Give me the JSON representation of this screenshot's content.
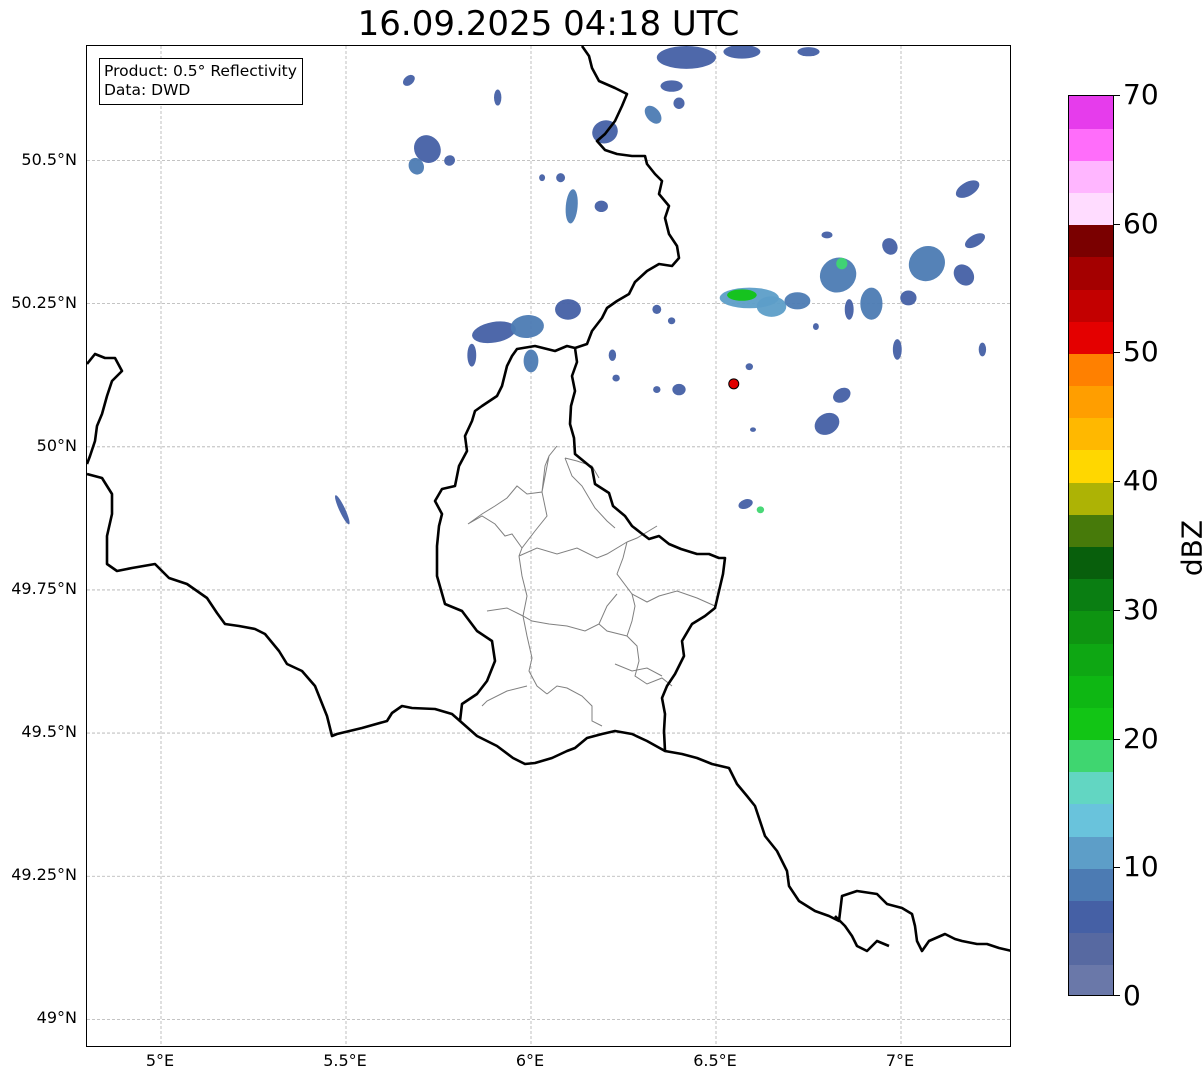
{
  "title": "16.09.2025 04:18 UTC",
  "info_box": {
    "product": "Product: 0.5° Reflectivity",
    "source": "Data: DWD"
  },
  "map": {
    "lon_range": [
      4.8,
      7.3
    ],
    "lat_range": [
      48.95,
      50.7
    ],
    "lat_ticks": [
      {
        "value": 50.5,
        "label": "50.5°N"
      },
      {
        "value": 50.25,
        "label": "50.25°N"
      },
      {
        "value": 50.0,
        "label": "50°N"
      },
      {
        "value": 49.75,
        "label": "49.75°N"
      },
      {
        "value": 49.5,
        "label": "49.5°N"
      },
      {
        "value": 49.25,
        "label": "49.25°N"
      },
      {
        "value": 49.0,
        "label": "49°N"
      }
    ],
    "lon_ticks": [
      {
        "value": 5.0,
        "label": "5°E"
      },
      {
        "value": 5.5,
        "label": "5.5°E"
      },
      {
        "value": 6.0,
        "label": "6°E"
      },
      {
        "value": 6.5,
        "label": "6.5°E"
      },
      {
        "value": 7.0,
        "label": "7°E"
      }
    ],
    "grid_color": "#b0b0b0",
    "border_color": "#000000",
    "admin_color": "#808080",
    "radar_site": {
      "lon": 6.548,
      "lat": 50.11,
      "color": "#e00000"
    },
    "echoes": [
      {
        "lon": 5.72,
        "lat": 50.52,
        "rx": 0.035,
        "ry": 0.025,
        "rot": -35,
        "dbz": 6
      },
      {
        "lon": 5.69,
        "lat": 50.49,
        "rx": 0.02,
        "ry": 0.015,
        "rot": -30,
        "dbz": 8
      },
      {
        "lon": 5.67,
        "lat": 50.64,
        "rx": 0.018,
        "ry": 0.008,
        "rot": -40,
        "dbz": 5
      },
      {
        "lon": 5.78,
        "lat": 50.5,
        "rx": 0.015,
        "ry": 0.009,
        "rot": -30,
        "dbz": 6
      },
      {
        "lon": 5.91,
        "lat": 50.61,
        "rx": 0.01,
        "ry": 0.014,
        "rot": 0,
        "dbz": 5
      },
      {
        "lon": 5.9,
        "lat": 50.2,
        "rx": 0.06,
        "ry": 0.018,
        "rot": -10,
        "dbz": 7
      },
      {
        "lon": 5.99,
        "lat": 50.21,
        "rx": 0.045,
        "ry": 0.02,
        "rot": -5,
        "dbz": 8
      },
      {
        "lon": 6.1,
        "lat": 50.24,
        "rx": 0.035,
        "ry": 0.018,
        "rot": 0,
        "dbz": 7
      },
      {
        "lon": 6.0,
        "lat": 50.15,
        "rx": 0.02,
        "ry": 0.02,
        "rot": 0,
        "dbz": 9
      },
      {
        "lon": 5.84,
        "lat": 50.16,
        "rx": 0.012,
        "ry": 0.02,
        "rot": 0,
        "dbz": 5
      },
      {
        "lon": 5.49,
        "lat": 49.89,
        "rx": 0.008,
        "ry": 0.028,
        "rot": -25,
        "dbz": 6
      },
      {
        "lon": 6.11,
        "lat": 50.42,
        "rx": 0.016,
        "ry": 0.03,
        "rot": 5,
        "dbz": 8
      },
      {
        "lon": 6.08,
        "lat": 50.47,
        "rx": 0.012,
        "ry": 0.008,
        "rot": 0,
        "dbz": 6
      },
      {
        "lon": 6.19,
        "lat": 50.42,
        "rx": 0.018,
        "ry": 0.01,
        "rot": 0,
        "dbz": 5
      },
      {
        "lon": 6.03,
        "lat": 50.47,
        "rx": 0.008,
        "ry": 0.006,
        "rot": 0,
        "dbz": 5
      },
      {
        "lon": 6.2,
        "lat": 50.55,
        "rx": 0.035,
        "ry": 0.02,
        "rot": -20,
        "dbz": 7
      },
      {
        "lon": 6.33,
        "lat": 50.58,
        "rx": 0.018,
        "ry": 0.018,
        "rot": -40,
        "dbz": 9
      },
      {
        "lon": 6.38,
        "lat": 50.63,
        "rx": 0.03,
        "ry": 0.01,
        "rot": 0,
        "dbz": 6
      },
      {
        "lon": 6.42,
        "lat": 50.68,
        "rx": 0.08,
        "ry": 0.02,
        "rot": 0,
        "dbz": 7
      },
      {
        "lon": 6.57,
        "lat": 50.69,
        "rx": 0.05,
        "ry": 0.012,
        "rot": 0,
        "dbz": 6
      },
      {
        "lon": 6.75,
        "lat": 50.69,
        "rx": 0.03,
        "ry": 0.008,
        "rot": 0,
        "dbz": 5
      },
      {
        "lon": 6.4,
        "lat": 50.6,
        "rx": 0.015,
        "ry": 0.01,
        "rot": 0,
        "dbz": 5
      },
      {
        "lon": 6.59,
        "lat": 50.26,
        "rx": 0.08,
        "ry": 0.018,
        "rot": 0,
        "dbz": 10
      },
      {
        "lon": 6.57,
        "lat": 50.265,
        "rx": 0.04,
        "ry": 0.01,
        "rot": 0,
        "dbz": 22
      },
      {
        "lon": 6.65,
        "lat": 50.245,
        "rx": 0.04,
        "ry": 0.018,
        "rot": 0,
        "dbz": 12
      },
      {
        "lon": 6.72,
        "lat": 50.255,
        "rx": 0.035,
        "ry": 0.015,
        "rot": 0,
        "dbz": 9
      },
      {
        "lon": 6.83,
        "lat": 50.3,
        "rx": 0.05,
        "ry": 0.03,
        "rot": -30,
        "dbz": 8
      },
      {
        "lon": 6.84,
        "lat": 50.32,
        "rx": 0.015,
        "ry": 0.01,
        "rot": 0,
        "dbz": 18
      },
      {
        "lon": 6.92,
        "lat": 50.25,
        "rx": 0.03,
        "ry": 0.028,
        "rot": 0,
        "dbz": 9
      },
      {
        "lon": 6.86,
        "lat": 50.24,
        "rx": 0.012,
        "ry": 0.018,
        "rot": 0,
        "dbz": 6
      },
      {
        "lon": 7.02,
        "lat": 50.26,
        "rx": 0.022,
        "ry": 0.013,
        "rot": 0,
        "dbz": 6
      },
      {
        "lon": 7.07,
        "lat": 50.32,
        "rx": 0.05,
        "ry": 0.03,
        "rot": -35,
        "dbz": 9
      },
      {
        "lon": 7.17,
        "lat": 50.3,
        "rx": 0.025,
        "ry": 0.02,
        "rot": -40,
        "dbz": 7
      },
      {
        "lon": 7.18,
        "lat": 50.45,
        "rx": 0.035,
        "ry": 0.012,
        "rot": -30,
        "dbz": 6
      },
      {
        "lon": 6.97,
        "lat": 50.35,
        "rx": 0.02,
        "ry": 0.015,
        "rot": -30,
        "dbz": 6
      },
      {
        "lon": 6.8,
        "lat": 50.37,
        "rx": 0.015,
        "ry": 0.006,
        "rot": 0,
        "dbz": 5
      },
      {
        "lon": 7.2,
        "lat": 50.36,
        "rx": 0.03,
        "ry": 0.01,
        "rot": -30,
        "dbz": 5
      },
      {
        "lon": 6.34,
        "lat": 50.24,
        "rx": 0.012,
        "ry": 0.008,
        "rot": 0,
        "dbz": 6
      },
      {
        "lon": 6.38,
        "lat": 50.22,
        "rx": 0.01,
        "ry": 0.006,
        "rot": 0,
        "dbz": 5
      },
      {
        "lon": 6.59,
        "lat": 50.14,
        "rx": 0.01,
        "ry": 0.006,
        "rot": 0,
        "dbz": 5
      },
      {
        "lon": 6.4,
        "lat": 50.1,
        "rx": 0.018,
        "ry": 0.01,
        "rot": 0,
        "dbz": 7
      },
      {
        "lon": 6.34,
        "lat": 50.1,
        "rx": 0.01,
        "ry": 0.006,
        "rot": 0,
        "dbz": 5
      },
      {
        "lon": 6.23,
        "lat": 50.12,
        "rx": 0.01,
        "ry": 0.006,
        "rot": 0,
        "dbz": 5
      },
      {
        "lon": 6.8,
        "lat": 50.04,
        "rx": 0.035,
        "ry": 0.018,
        "rot": -30,
        "dbz": 7
      },
      {
        "lon": 6.84,
        "lat": 50.09,
        "rx": 0.025,
        "ry": 0.012,
        "rot": -30,
        "dbz": 6
      },
      {
        "lon": 6.58,
        "lat": 49.9,
        "rx": 0.02,
        "ry": 0.008,
        "rot": -20,
        "dbz": 6
      },
      {
        "lon": 6.62,
        "lat": 49.89,
        "rx": 0.01,
        "ry": 0.006,
        "rot": 0,
        "dbz": 18
      },
      {
        "lon": 6.6,
        "lat": 50.03,
        "rx": 0.008,
        "ry": 0.004,
        "rot": 0,
        "dbz": 5
      },
      {
        "lon": 6.99,
        "lat": 50.17,
        "rx": 0.012,
        "ry": 0.018,
        "rot": 0,
        "dbz": 6
      },
      {
        "lon": 7.22,
        "lat": 50.17,
        "rx": 0.01,
        "ry": 0.012,
        "rot": 0,
        "dbz": 6
      },
      {
        "lon": 6.77,
        "lat": 50.21,
        "rx": 0.008,
        "ry": 0.006,
        "rot": 0,
        "dbz": 5
      },
      {
        "lon": 6.22,
        "lat": 50.16,
        "rx": 0.01,
        "ry": 0.01,
        "rot": 0,
        "dbz": 5
      }
    ]
  },
  "colorbar": {
    "label": "dBZ",
    "min": 0,
    "max": 70,
    "ticks": [
      {
        "value": 0,
        "label": "0"
      },
      {
        "value": 10,
        "label": "10"
      },
      {
        "value": 20,
        "label": "20"
      },
      {
        "value": 30,
        "label": "30"
      },
      {
        "value": 40,
        "label": "40"
      },
      {
        "value": 50,
        "label": "50"
      },
      {
        "value": 60,
        "label": "60"
      },
      {
        "value": 70,
        "label": "70"
      }
    ],
    "colors": [
      "#6a78a9",
      "#5769a1",
      "#4560a5",
      "#4c7bb3",
      "#5d9ec8",
      "#69c3dc",
      "#62d6c2",
      "#3fd670",
      "#12c515",
      "#0eb713",
      "#0ea713",
      "#0e9411",
      "#0a7e12",
      "#085f0c",
      "#477a0a",
      "#adb305",
      "#ffd700",
      "#ffb800",
      "#ff9e00",
      "#ff8000",
      "#e40000",
      "#c30000",
      "#a40000",
      "#7a0000",
      "#ffdcff",
      "#ffb6ff",
      "#ff6dfa",
      "#e63cec"
    ]
  }
}
